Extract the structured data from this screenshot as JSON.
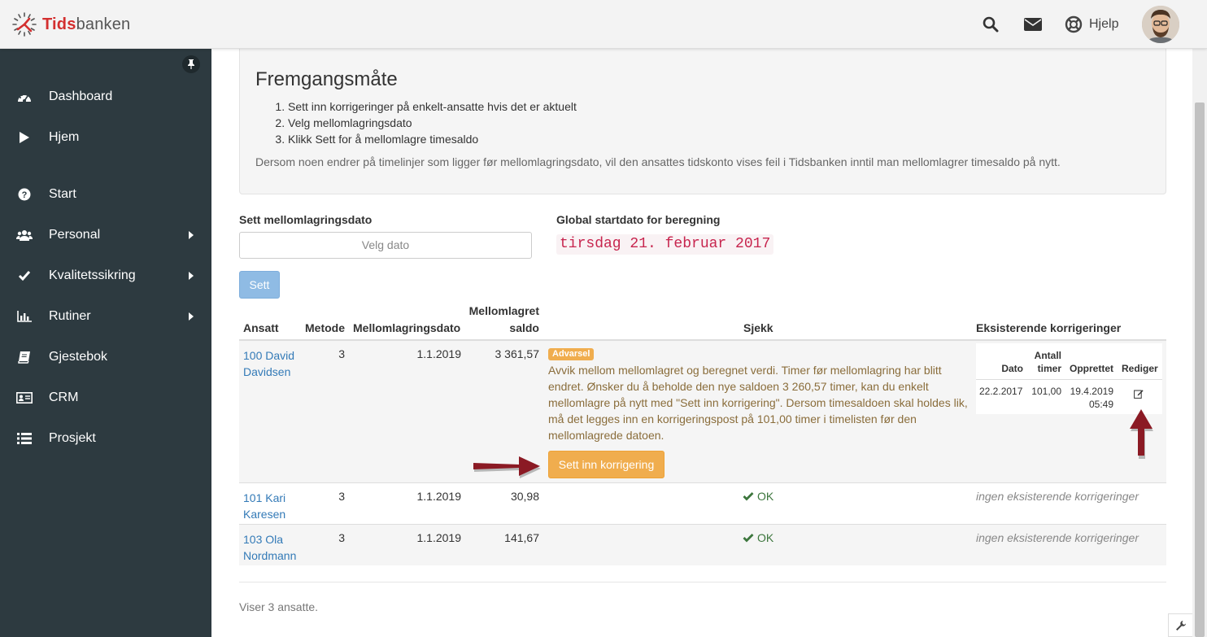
{
  "brand": {
    "part1": "Tids",
    "part2": "banken"
  },
  "header": {
    "help_label": "Hjelp"
  },
  "sidebar": {
    "items": [
      {
        "label": "Dashboard",
        "icon": "dashboard-icon"
      },
      {
        "label": "Hjem",
        "icon": "play-icon"
      },
      {
        "label": "Start",
        "icon": "question-circle-icon"
      },
      {
        "label": "Personal",
        "icon": "users-icon"
      },
      {
        "label": "Kvalitetssikring",
        "icon": "check-icon"
      },
      {
        "label": "Rutiner",
        "icon": "bar-chart-icon"
      },
      {
        "label": "Gjestebok",
        "icon": "book-icon"
      },
      {
        "label": "CRM",
        "icon": "id-card-icon"
      },
      {
        "label": "Prosjekt",
        "icon": "list-icon"
      }
    ]
  },
  "info": {
    "title": "Fremgangsmåte",
    "steps": [
      "Sett inn korrigeringer på enkelt-ansatte hvis det er aktuelt",
      "Velg mellomlagringsdato",
      "Klikk Sett for å mellomlagre timesaldo"
    ],
    "note": "Dersom noen endrer på timelinjer som ligger før mellomlagringsdato, vil den ansattes tidskonto vises feil i Tidsbanken inntil man mellomlagrer timesaldo på nytt."
  },
  "form": {
    "date_label": "Sett mellomlagringsdato",
    "date_placeholder": "Velg dato",
    "global_label": "Global startdato for beregning",
    "global_value": "tirsdag 21. februar 2017",
    "set_button": "Sett"
  },
  "table": {
    "headers": {
      "ansatt": "Ansatt",
      "metode": "Metode",
      "dato": "Mellomlagringsdato",
      "saldo_line1": "Mellomlagret",
      "saldo_line2": "saldo",
      "sjekk": "Sjekk",
      "korr": "Eksisterende korrigeringer"
    },
    "rows": [
      {
        "name_line1": "100 David",
        "name_line2": "Davidsen",
        "metode": "3",
        "dato": "1.1.2019",
        "saldo": "3 361,57",
        "badge": "Advarsel",
        "warning": "Avvik mellom mellomlagret og beregnet verdi. Timer før mellomlagring har blitt endret. Ønsker du å beholde den nye saldoen 3 260,57 timer, kan du enkelt mellomlagre på nytt med \"Sett inn korrigering\". Dersom timesaldoen skal holdes lik, må det legges inn en korrigeringspost på 101,00 timer i timelisten før den mellomlagrede datoen.",
        "button": "Sett inn korrigering",
        "corrections": {
          "headers": {
            "dato": "Dato",
            "antall1": "Antall",
            "antall2": "timer",
            "opprettet": "Opprettet",
            "rediger": "Rediger"
          },
          "row": {
            "dato": "22.2.2017",
            "antall": "101,00",
            "opprettet1": "19.4.2019",
            "opprettet2": "05:49"
          }
        }
      },
      {
        "name_line1": "101 Kari",
        "name_line2": "Karesen",
        "metode": "3",
        "dato": "1.1.2019",
        "saldo": "30,98",
        "status": "OK",
        "none": "ingen eksisterende korrigeringer"
      },
      {
        "name_line1": "103 Ola",
        "name_line2": "Nordmann",
        "metode": "3",
        "dato": "1.1.2019",
        "saldo": "141,67",
        "status": "OK",
        "none": "ingen eksisterende korrigeringer"
      }
    ]
  },
  "footer": {
    "text": "Viser 3 ansatte."
  },
  "colors": {
    "sidebar": "#2d3a40",
    "link": "#337ab7",
    "warning": "#f0ad4e",
    "arrow": "#8b1a24",
    "ok": "#3c763d"
  }
}
